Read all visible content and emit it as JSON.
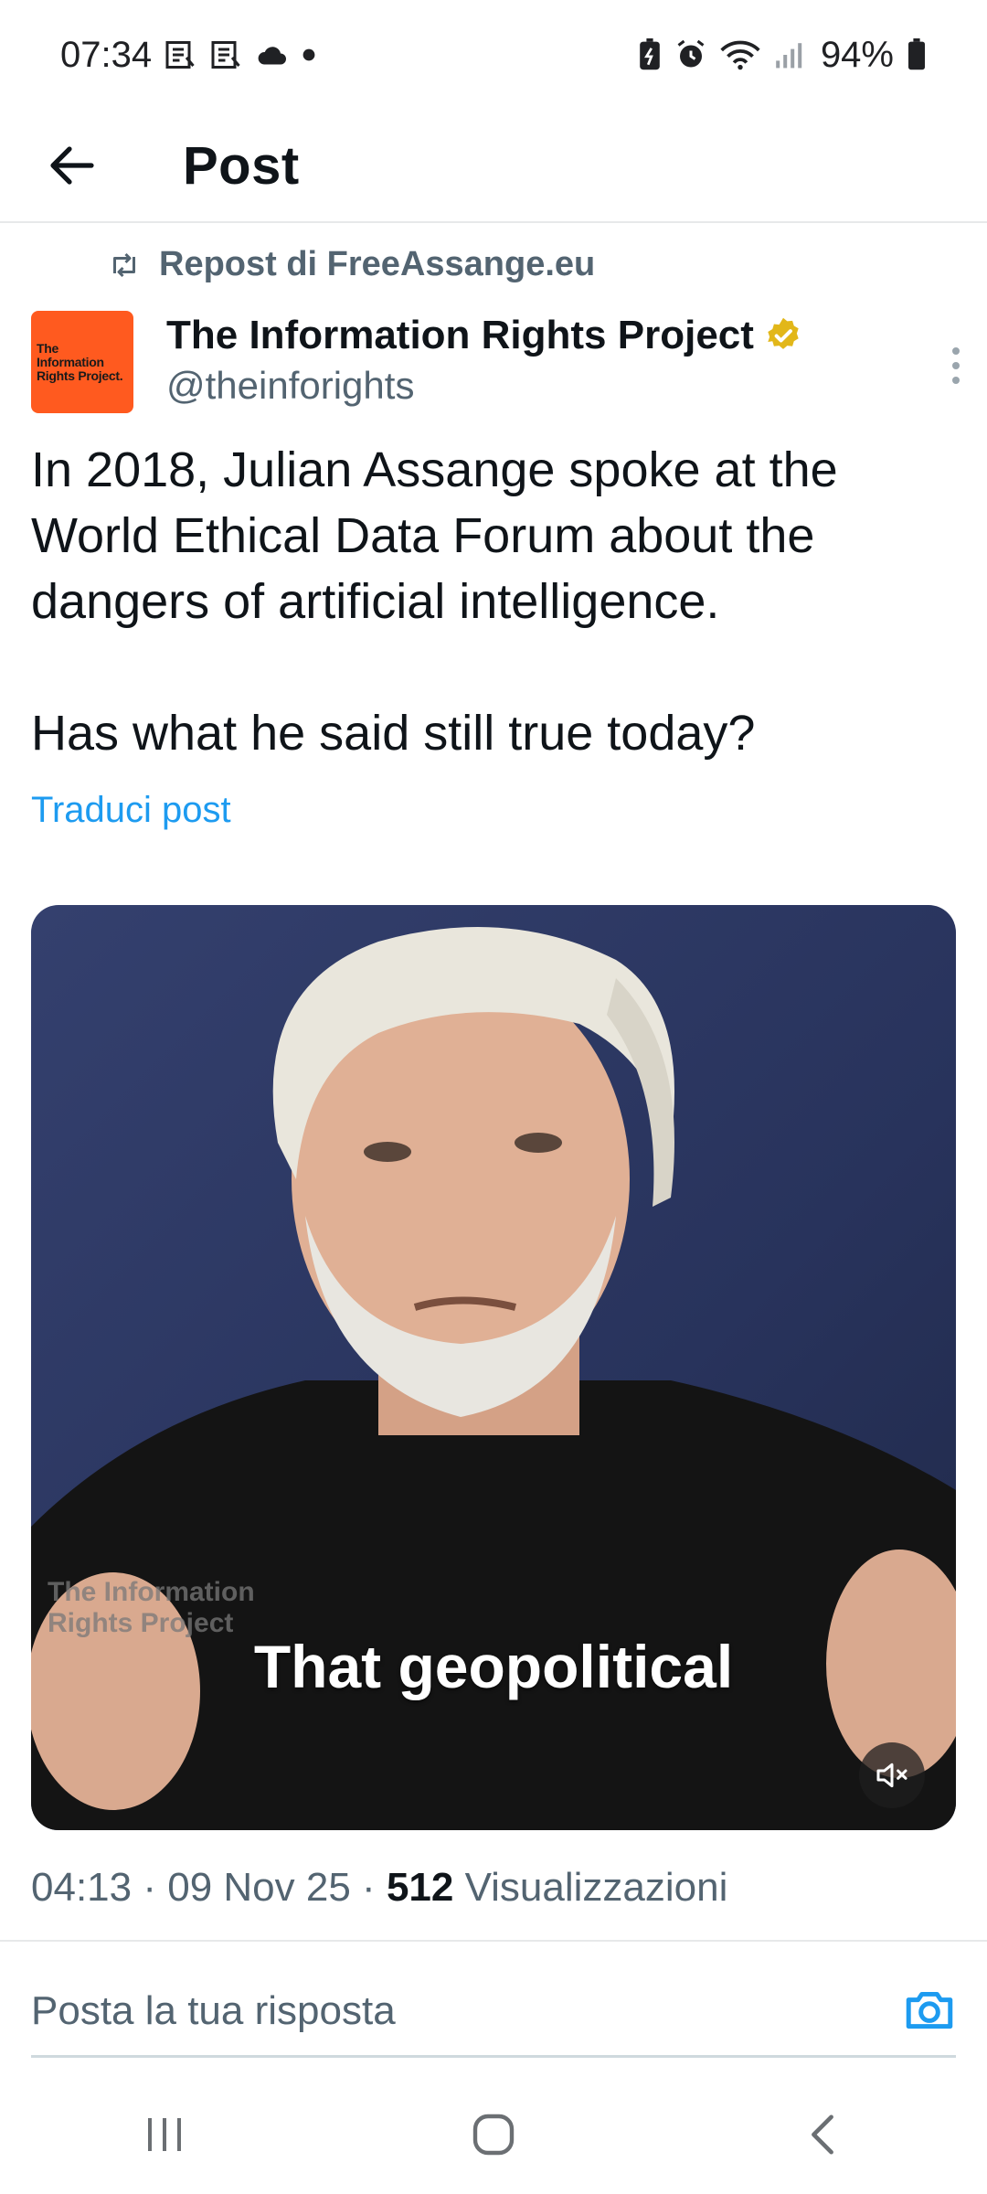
{
  "status_bar": {
    "time": "07:34",
    "battery": "94%",
    "icons_left": [
      "news-icon",
      "news-icon",
      "cloud-icon",
      "dot-icon"
    ],
    "icons_right": [
      "battery-saver-icon",
      "alarm-icon",
      "wifi-icon",
      "signal-icon",
      "battery-icon"
    ]
  },
  "header": {
    "title": "Post"
  },
  "repost": {
    "label": "Repost di FreeAssange.eu"
  },
  "author": {
    "name": "The Information Rights Project",
    "handle": "@theinforights",
    "avatar_text": "The Information Rights Project.",
    "avatar_color": "#ff5a1f",
    "verified_color": "#e2b719"
  },
  "post": {
    "paragraphs": [
      "In 2018, Julian Assange spoke at the World Ethical Data Forum about the dangers of artificial intelligence.",
      "Has what he said still true today?"
    ],
    "translate_label": "Traduci post"
  },
  "media": {
    "caption": "That geopolitical",
    "watermark_line1": "The Information",
    "watermark_line2": "Rights Project"
  },
  "meta": {
    "time": "04:13",
    "date": "09 Nov 25",
    "views": "512",
    "views_label": "Visualizzazioni"
  },
  "reply": {
    "placeholder": "Posta la tua risposta"
  },
  "colors": {
    "accent": "#1d9bf0",
    "muted": "#536471"
  }
}
